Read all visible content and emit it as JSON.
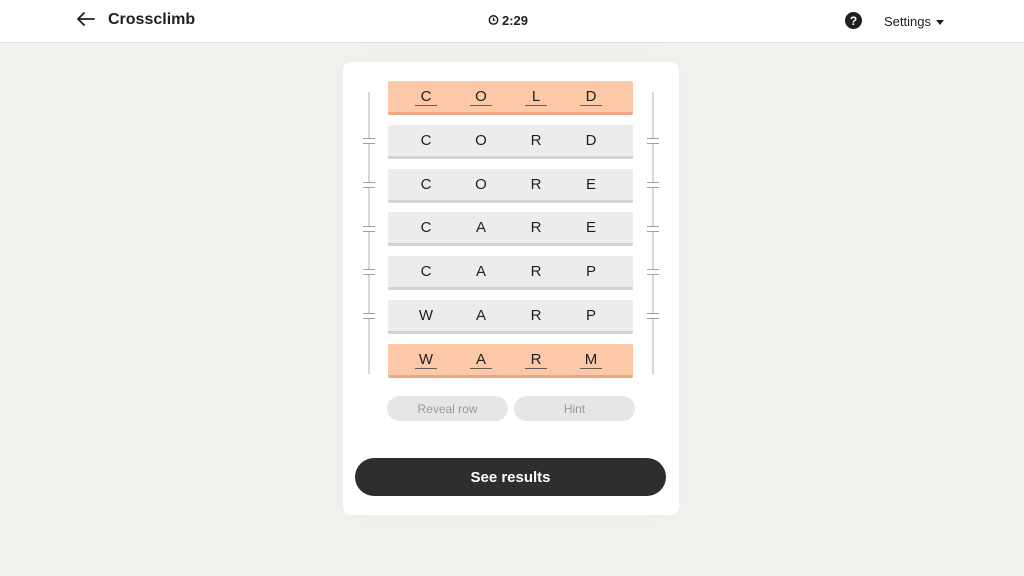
{
  "header": {
    "title": "Crossclimb",
    "timer": "2:29",
    "settings_label": "Settings",
    "help_symbol": "?"
  },
  "icons": {
    "back": "back-arrow-icon",
    "timer": "clock-icon",
    "help": "question-circle-icon",
    "settings": "chevron-down-icon"
  },
  "board": {
    "rows": [
      {
        "letters": [
          "C",
          "O",
          "L",
          "D"
        ],
        "fixed": true
      },
      {
        "letters": [
          "C",
          "O",
          "R",
          "D"
        ],
        "fixed": false
      },
      {
        "letters": [
          "C",
          "O",
          "R",
          "E"
        ],
        "fixed": false
      },
      {
        "letters": [
          "C",
          "A",
          "R",
          "E"
        ],
        "fixed": false
      },
      {
        "letters": [
          "C",
          "A",
          "R",
          "P"
        ],
        "fixed": false
      },
      {
        "letters": [
          "W",
          "A",
          "R",
          "P"
        ],
        "fixed": false
      },
      {
        "letters": [
          "W",
          "A",
          "R",
          "M"
        ],
        "fixed": true
      }
    ]
  },
  "actions": {
    "reveal_label": "Reveal row",
    "hint_label": "Hint",
    "results_label": "See results"
  },
  "colors": {
    "fixed_row": "#fcc8a8",
    "row": "#ececec",
    "primary_button": "#2e2e2e"
  }
}
